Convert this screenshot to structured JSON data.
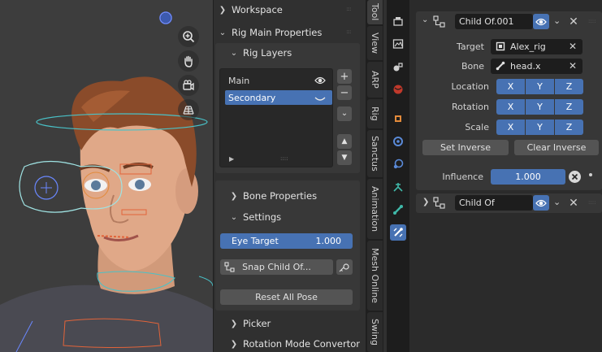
{
  "sidebar": {
    "workspace": "Workspace",
    "rig_main_properties": "Rig Main Properties",
    "rig_layers": "Rig Layers",
    "layers": [
      {
        "label": "Main"
      },
      {
        "label": "Secondary"
      }
    ],
    "bone_properties": "Bone Properties",
    "settings": "Settings",
    "eye_target_label": "Eye Target",
    "eye_target_value": "1.000",
    "snap_child_of": "Snap Child Of...",
    "reset_all_pose": "Reset All Pose",
    "picker": "Picker",
    "rotation_mode_convertor": "Rotation Mode Convertor"
  },
  "tabs": [
    "Tool",
    "View",
    "ARP",
    "Rig",
    "Sanctus",
    "Animation",
    "Mesh Online",
    "Swing"
  ],
  "constraints": [
    {
      "name": "Child Of.001",
      "target_label": "Target",
      "target_value": "Alex_rig",
      "bone_label": "Bone",
      "bone_value": "head.x",
      "location_label": "Location",
      "rotation_label": "Rotation",
      "scale_label": "Scale",
      "axes": [
        "X",
        "Y",
        "Z"
      ],
      "set_inverse": "Set Inverse",
      "clear_inverse": "Clear Inverse",
      "influence_label": "Influence",
      "influence_value": "1.000"
    },
    {
      "name": "Child Of"
    }
  ],
  "colors": {
    "accent": "#4772b3",
    "panel": "#373737",
    "background": "#2b2b2b"
  }
}
